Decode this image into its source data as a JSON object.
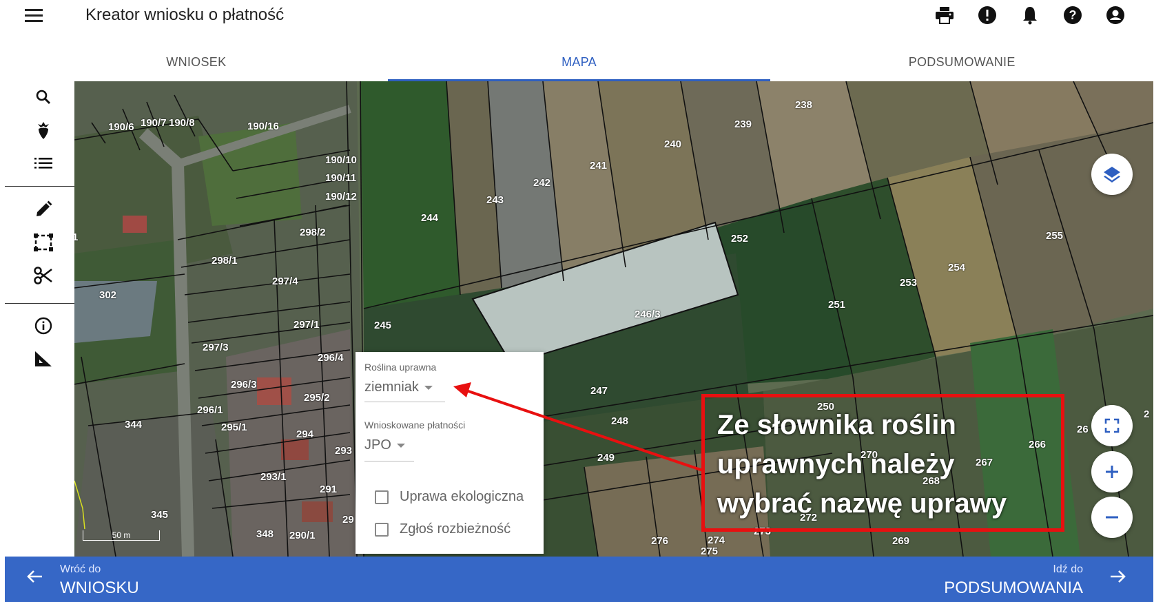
{
  "app": {
    "title": "Kreator wniosku o płatność",
    "menu_icon": "hamburger-menu-icon"
  },
  "header_icons": [
    "print-icon",
    "alert-icon",
    "notifications-icon",
    "help-icon",
    "account-icon"
  ],
  "tabs": [
    {
      "label": "WNIOSEK",
      "active": false
    },
    {
      "label": "MAPA",
      "active": true
    },
    {
      "label": "PODSUMOWANIE",
      "active": false
    }
  ],
  "toolbar_icons": [
    "search-icon",
    "crop-beet-icon",
    "list-icon",
    "pencil-icon",
    "select-area-icon",
    "scissors-icon",
    "info-icon",
    "measure-icon"
  ],
  "map": {
    "scale_label": "50 m",
    "parcels": [
      {
        "label": "190/6"
      },
      {
        "label": "190/7"
      },
      {
        "label": "190/8"
      },
      {
        "label": "190/16"
      },
      {
        "label": "190/10"
      },
      {
        "label": "190/11"
      },
      {
        "label": "190/12"
      },
      {
        "label": "298/2"
      },
      {
        "label": "298/1"
      },
      {
        "label": "297/4"
      },
      {
        "label": "302"
      },
      {
        "label": "297/1"
      },
      {
        "label": "245"
      },
      {
        "label": "297/3"
      },
      {
        "label": "296/4"
      },
      {
        "label": "296/3"
      },
      {
        "label": "295/2"
      },
      {
        "label": "296/1"
      },
      {
        "label": "344"
      },
      {
        "label": "295/1"
      },
      {
        "label": "294"
      },
      {
        "label": "293"
      },
      {
        "label": "293/1"
      },
      {
        "label": "291"
      },
      {
        "label": "345"
      },
      {
        "label": "29"
      },
      {
        "label": "348"
      },
      {
        "label": "290/1"
      },
      {
        "label": "244"
      },
      {
        "label": "243"
      },
      {
        "label": "242"
      },
      {
        "label": "241"
      },
      {
        "label": "240"
      },
      {
        "label": "239"
      },
      {
        "label": "238"
      },
      {
        "label": "252"
      },
      {
        "label": "246/3"
      },
      {
        "label": "251"
      },
      {
        "label": "253"
      },
      {
        "label": "254"
      },
      {
        "label": "255"
      },
      {
        "label": "247"
      },
      {
        "label": "248"
      },
      {
        "label": "249"
      },
      {
        "label": "250"
      },
      {
        "label": "270"
      },
      {
        "label": "268"
      },
      {
        "label": "267"
      },
      {
        "label": "266"
      },
      {
        "label": "272"
      },
      {
        "label": "273"
      },
      {
        "label": "274"
      },
      {
        "label": "275"
      },
      {
        "label": "276"
      },
      {
        "label": "269"
      },
      {
        "label": "26"
      },
      {
        "label": "2"
      },
      {
        "label": "1"
      }
    ],
    "controls": [
      "layers-icon",
      "fullscreen-icon",
      "zoom-in-icon",
      "zoom-out-icon"
    ]
  },
  "popup": {
    "crop_label": "Roślina uprawna",
    "crop_value": "ziemniak",
    "payments_label": "Wnioskowane płatności",
    "payments_value": "JPO",
    "checkbox_eco": "Uprawa ekologiczna",
    "checkbox_discrepancy": "Zgłoś rozbieżność"
  },
  "annotation": {
    "lines": [
      "Ze słownika roślin",
      "uprawnych należy",
      "wybrać nazwę uprawy"
    ],
    "color": "#e81010"
  },
  "footer": {
    "back_small": "Wróć do",
    "back_big": "WNIOSKU",
    "forward_small": "Idź do",
    "forward_big": "PODSUMOWANIA",
    "color": "#3667c6"
  }
}
